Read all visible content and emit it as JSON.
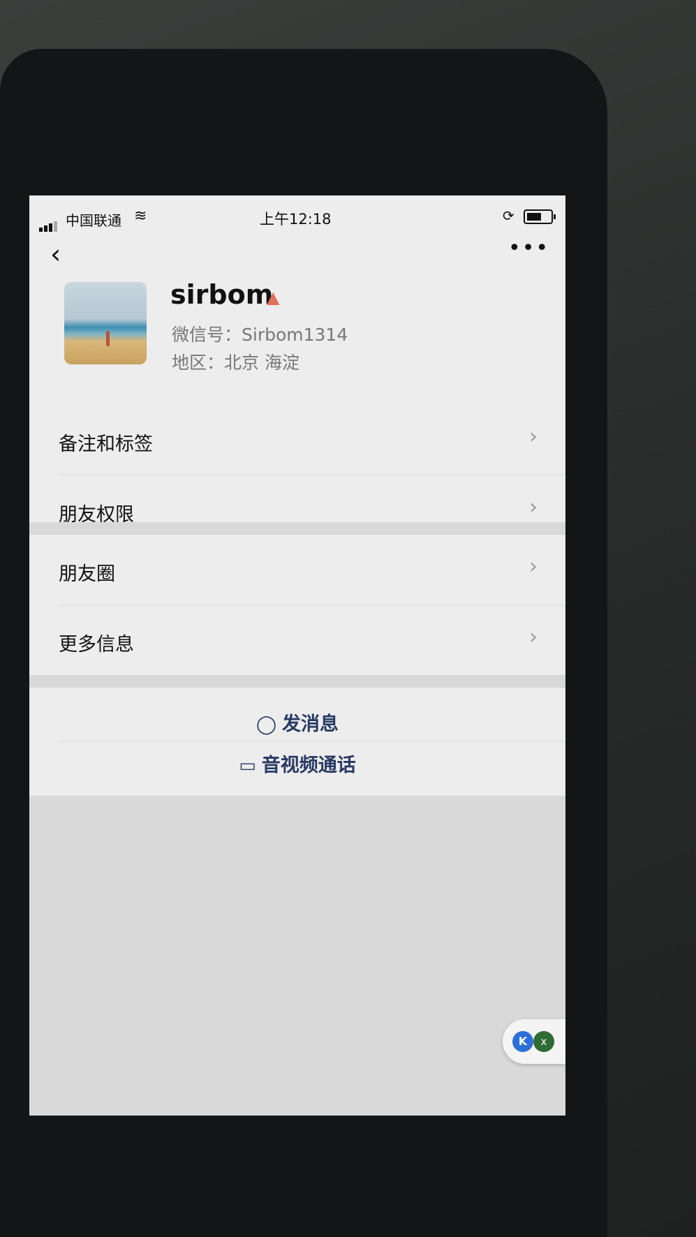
{
  "status_bar": {
    "carrier": "中国联通",
    "time": "上午12:18"
  },
  "nav": {
    "back_icon": "‹",
    "more_icon": "•••"
  },
  "profile": {
    "name": "sirbom",
    "gender_icon": "person-icon",
    "wechat_id": "微信号：Sirbom1314",
    "region": "地区：北京 海淀"
  },
  "menu": {
    "remarks_tags": "备注和标签",
    "friend_permissions": "朋友权限",
    "moments": "朋友圈",
    "more_info": "更多信息"
  },
  "actions": {
    "send_message": "发消息",
    "video_call": "音视频通话"
  },
  "floating_widget": {
    "left_badge": "K",
    "close": "x"
  },
  "colors": {
    "action_text": "#283a63",
    "gender_icon": "#e0705c",
    "background": "#ededed"
  }
}
